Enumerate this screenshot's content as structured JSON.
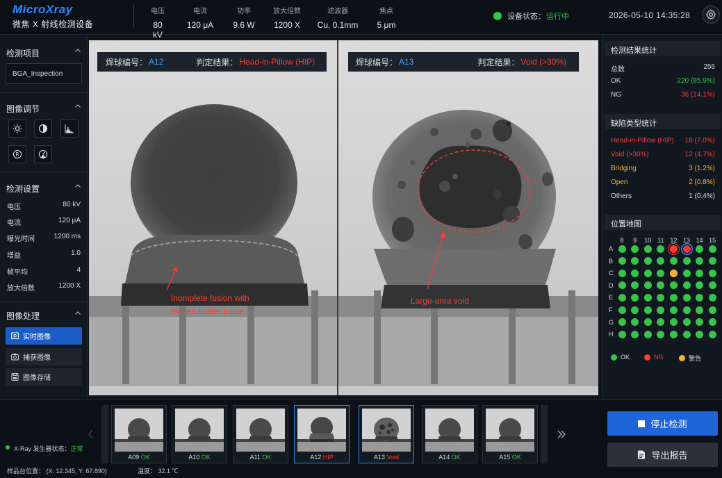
{
  "header": {
    "brand": "MicroXray",
    "product": "微焦 X 射线检测设备",
    "params": [
      {
        "label": "电压",
        "value": "80 kV"
      },
      {
        "label": "电流",
        "value": "120 μA"
      },
      {
        "label": "功率",
        "value": "9.6 W"
      },
      {
        "label": "放大倍数",
        "value": "1200 X"
      },
      {
        "label": "滤波器",
        "value": "Cu. 0.1mm"
      },
      {
        "label": "焦点",
        "value": "5 μm"
      }
    ],
    "device_status_label": "设备状态：",
    "device_status_value": "运行中",
    "datetime": "2026-05-10  14:35:28"
  },
  "left_panel": {
    "inspection_title": "检测项目",
    "inspection_value": "BGA_Inspection",
    "image_adjust_title": "图像调节",
    "settings_title": "检测设置",
    "settings": [
      {
        "label": "电压",
        "value": "80 kV"
      },
      {
        "label": "电流",
        "value": "120 μA"
      },
      {
        "label": "曝光时间",
        "value": "1200 ms"
      },
      {
        "label": "增益",
        "value": "1.0"
      },
      {
        "label": "帧平均",
        "value": "4"
      },
      {
        "label": "放大倍数",
        "value": "1200 X"
      }
    ],
    "processing_title": "图像处理",
    "processing": [
      {
        "label": "实时图像"
      },
      {
        "label": "捕获图像"
      },
      {
        "label": "图像存储"
      }
    ]
  },
  "viewer": {
    "left": {
      "ball_label": "焊球编号：",
      "ball_id": "A12",
      "result_label": "判定结果：",
      "result": "Head-in-Pillow (HIP)",
      "annotation_1": "Inomplete fusion with",
      "annotation_2": "molten solder paste"
    },
    "right": {
      "ball_label": "焊球编号：",
      "ball_id": "A13",
      "result_label": "判定结果：",
      "result": "Void (>30%)",
      "annotation": "Large-area void"
    }
  },
  "right_panel": {
    "stats_title": "检测结果统计",
    "stats": [
      {
        "label": "总数",
        "value": "256",
        "color": "#d6dbe2"
      },
      {
        "label": "OK",
        "value": "220 (85.9%)",
        "color": "#37c44a"
      },
      {
        "label": "NG",
        "value": "36 (14.1%)",
        "color": "#ff3b30"
      }
    ],
    "defect_title": "缺陷类型统计",
    "defects": [
      {
        "label": "Head-in-Pillow (HIP)",
        "value": "18 (7.0%)",
        "color": "#ff3b30"
      },
      {
        "label": "Void (>30%)",
        "value": "12 (4.7%)",
        "color": "#ff3b30"
      },
      {
        "label": "Bridging",
        "value": "3 (1.2%)",
        "color": "#f2b43c"
      },
      {
        "label": "Open",
        "value": "2 (0.8%)",
        "color": "#f2b43c"
      },
      {
        "label": "Others",
        "value": "1 (0.4%)",
        "color": "#d6dbe2"
      }
    ],
    "map_title": "位置地图",
    "map_columns": [
      "8",
      "9",
      "10",
      "11",
      "12",
      "13",
      "14",
      "15"
    ],
    "map_rows": [
      "A",
      "B",
      "C",
      "D",
      "E",
      "F",
      "G",
      "H"
    ],
    "map_status": [
      [
        "ok",
        "ok",
        "ok",
        "ok",
        "ng-hip",
        "ng-void",
        "ok",
        "ok"
      ],
      [
        "ok",
        "ok",
        "ok",
        "ok",
        "ok",
        "ok",
        "ok",
        "ok"
      ],
      [
        "ok",
        "ok",
        "ok",
        "ok",
        "warn",
        "ok",
        "ok",
        "ok"
      ],
      [
        "ok",
        "ok",
        "ok",
        "ok",
        "ok",
        "ok",
        "ok",
        "ok"
      ],
      [
        "ok",
        "ok",
        "ok",
        "ok",
        "ok",
        "ok",
        "ok",
        "ok"
      ],
      [
        "ok",
        "ok",
        "ok",
        "ok",
        "ok",
        "ok",
        "ok",
        "ok"
      ],
      [
        "ok",
        "ok",
        "ok",
        "ok",
        "ok",
        "ok",
        "ok",
        "ok"
      ],
      [
        "ok",
        "ok",
        "ok",
        "ok",
        "ok",
        "ok",
        "ok",
        "ok"
      ]
    ],
    "legend": [
      {
        "label": "OK",
        "color": "#37c44a",
        "text_color": "#d6dbe2"
      },
      {
        "label": "NG",
        "color": "#ff3b30",
        "text_color": "#ff3b30"
      },
      {
        "label": "警告",
        "color": "#f2b43c",
        "text_color": "#d6dbe2"
      }
    ]
  },
  "thumbnails": [
    {
      "id": "A09",
      "result": "OK",
      "color": "#37c44a",
      "type": "ok"
    },
    {
      "id": "A10",
      "result": "OK",
      "color": "#37c44a",
      "type": "ok"
    },
    {
      "id": "A11",
      "result": "OK",
      "color": "#37c44a",
      "type": "ok"
    },
    {
      "id": "A12",
      "result": "HIP",
      "color": "#ff3b30",
      "type": "hip"
    },
    {
      "id": "A13",
      "result": "Void",
      "color": "#ff3b30",
      "type": "void"
    },
    {
      "id": "A14",
      "result": "OK",
      "color": "#37c44a",
      "type": "ok"
    },
    {
      "id": "A15",
      "result": "OK",
      "color": "#37c44a",
      "type": "ok"
    }
  ],
  "footer": {
    "xray_status_label": "X-Ray 发生器状态：",
    "xray_status_value": "正常",
    "stage_position": "样品台位置：  (X: 12.345, Y: 67.890)",
    "temperature": "温度：  32.1 ℃",
    "stop_button": "停止检测",
    "export_button": "导出报告"
  }
}
